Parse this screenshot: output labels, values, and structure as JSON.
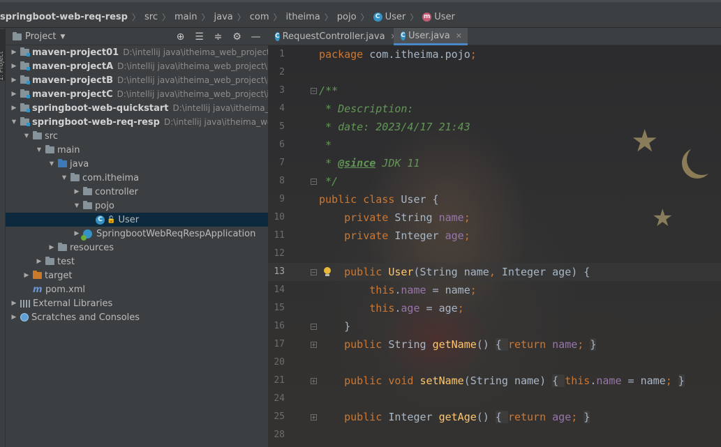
{
  "breadcrumb": {
    "items": [
      {
        "label": "springboot-web-req-resp",
        "icon": ""
      },
      {
        "label": "src",
        "icon": ""
      },
      {
        "label": "main",
        "icon": ""
      },
      {
        "label": "java",
        "icon": ""
      },
      {
        "label": "com",
        "icon": ""
      },
      {
        "label": "itheima",
        "icon": ""
      },
      {
        "label": "pojo",
        "icon": ""
      },
      {
        "label": "User",
        "icon": "C"
      },
      {
        "label": "User",
        "icon": "m"
      }
    ]
  },
  "left_strip": {
    "tab_label": "1: Project"
  },
  "project_panel": {
    "title": "Project",
    "header_icons": [
      "target-icon",
      "expand-all-icon",
      "collapse-all-icon",
      "gear-icon",
      "minimize-icon"
    ],
    "tree": [
      {
        "label": "maven-project01",
        "path": "D:\\intellij java\\itheima_web_project\\ithe",
        "depth": 0,
        "arrow": "right",
        "icon": "module",
        "bold": true
      },
      {
        "label": "maven-projectA",
        "path": "D:\\intellij java\\itheima_web_project\\ithei",
        "depth": 0,
        "arrow": "right",
        "icon": "module",
        "bold": true
      },
      {
        "label": "maven-projectB",
        "path": "D:\\intellij java\\itheima_web_project\\ithei",
        "depth": 0,
        "arrow": "right",
        "icon": "module",
        "bold": true
      },
      {
        "label": "maven-projectC",
        "path": "D:\\intellij java\\itheima_web_project\\ithei",
        "depth": 0,
        "arrow": "right",
        "icon": "module",
        "bold": true
      },
      {
        "label": "springboot-web-quickstart",
        "path": "D:\\intellij java\\itheima_web_p",
        "depth": 0,
        "arrow": "right",
        "icon": "module",
        "bold": true
      },
      {
        "label": "springboot-web-req-resp",
        "path": "D:\\intellij java\\itheima_web_pr",
        "depth": 0,
        "arrow": "down",
        "icon": "module",
        "bold": true
      },
      {
        "label": "src",
        "path": "",
        "depth": 1,
        "arrow": "down",
        "icon": "folder",
        "bold": false
      },
      {
        "label": "main",
        "path": "",
        "depth": 2,
        "arrow": "down",
        "icon": "folder",
        "bold": false
      },
      {
        "label": "java",
        "path": "",
        "depth": 3,
        "arrow": "down",
        "icon": "folder-blue",
        "bold": false
      },
      {
        "label": "com.itheima",
        "path": "",
        "depth": 4,
        "arrow": "down",
        "icon": "package",
        "bold": false
      },
      {
        "label": "controller",
        "path": "",
        "depth": 5,
        "arrow": "right",
        "icon": "package",
        "bold": false
      },
      {
        "label": "pojo",
        "path": "",
        "depth": 5,
        "arrow": "down",
        "icon": "package",
        "bold": false
      },
      {
        "label": "User",
        "path": "",
        "depth": 6,
        "arrow": "none",
        "icon": "class",
        "bold": false,
        "selected": true
      },
      {
        "label": "SpringbootWebReqRespApplication",
        "path": "",
        "depth": 5,
        "arrow": "right",
        "icon": "spring-app",
        "bold": false
      },
      {
        "label": "resources",
        "path": "",
        "depth": 3,
        "arrow": "right",
        "icon": "resources",
        "bold": false
      },
      {
        "label": "test",
        "path": "",
        "depth": 2,
        "arrow": "right",
        "icon": "folder",
        "bold": false
      },
      {
        "label": "target",
        "path": "",
        "depth": 1,
        "arrow": "right",
        "icon": "folder-orange",
        "bold": false
      },
      {
        "label": "pom.xml",
        "path": "",
        "depth": 1,
        "arrow": "none",
        "icon": "maven",
        "bold": false
      },
      {
        "label": "External Libraries",
        "path": "",
        "depth": 0,
        "arrow": "right",
        "icon": "libraries",
        "bold": false
      },
      {
        "label": "Scratches and Consoles",
        "path": "",
        "depth": 0,
        "arrow": "right",
        "icon": "scratches",
        "bold": false
      }
    ]
  },
  "editor": {
    "tabs": [
      {
        "label": "RequestController.java",
        "active": false
      },
      {
        "label": "User.java",
        "active": true
      }
    ],
    "current_line": "13",
    "lines": [
      {
        "num": "1",
        "fold": "",
        "tokens": [
          [
            "kw",
            "package "
          ],
          [
            "",
            "com.itheima.pojo"
          ],
          [
            "kw",
            ";"
          ]
        ]
      },
      {
        "num": "2",
        "fold": "",
        "tokens": []
      },
      {
        "num": "3",
        "fold": "open",
        "tokens": [
          [
            "cm",
            "/**"
          ]
        ]
      },
      {
        "num": "4",
        "fold": "",
        "tokens": [
          [
            "cm",
            " * Description:"
          ]
        ]
      },
      {
        "num": "5",
        "fold": "",
        "tokens": [
          [
            "cm",
            " * date: 2023/4/17 21:43"
          ]
        ]
      },
      {
        "num": "6",
        "fold": "",
        "tokens": [
          [
            "cm",
            " *"
          ]
        ]
      },
      {
        "num": "7",
        "fold": "",
        "tokens": [
          [
            "cm",
            " * "
          ],
          [
            "tag",
            "@since"
          ],
          [
            "cm",
            " JDK 11"
          ]
        ]
      },
      {
        "num": "8",
        "fold": "open",
        "tokens": [
          [
            "cm",
            " */"
          ]
        ]
      },
      {
        "num": "9",
        "fold": "",
        "tokens": [
          [
            "kw",
            "public class "
          ],
          [
            "",
            "User {"
          ]
        ]
      },
      {
        "num": "10",
        "fold": "",
        "tokens": [
          [
            "",
            "    "
          ],
          [
            "kw",
            "private "
          ],
          [
            "",
            "String "
          ],
          [
            "fld",
            "name"
          ],
          [
            "kw",
            ";"
          ]
        ]
      },
      {
        "num": "11",
        "fold": "",
        "tokens": [
          [
            "",
            "    "
          ],
          [
            "kw",
            "private "
          ],
          [
            "",
            "Integer "
          ],
          [
            "fld",
            "age"
          ],
          [
            "kw",
            ";"
          ]
        ]
      },
      {
        "num": "12",
        "fold": "",
        "tokens": []
      },
      {
        "num": "13",
        "fold": "open",
        "bulb": true,
        "tokens": [
          [
            "",
            "    "
          ],
          [
            "kw",
            "public "
          ],
          [
            "fn",
            "User"
          ],
          [
            "",
            "(String name"
          ],
          [
            "kw",
            ", "
          ],
          [
            "",
            "Integer age) {"
          ]
        ]
      },
      {
        "num": "14",
        "fold": "",
        "tokens": [
          [
            "",
            "        "
          ],
          [
            "kw",
            "this"
          ],
          [
            "",
            "."
          ],
          [
            "fld",
            "name"
          ],
          [
            "",
            " = name"
          ],
          [
            "kw",
            ";"
          ]
        ]
      },
      {
        "num": "15",
        "fold": "",
        "tokens": [
          [
            "",
            "        "
          ],
          [
            "kw",
            "this"
          ],
          [
            "",
            "."
          ],
          [
            "fld",
            "age"
          ],
          [
            "",
            " = age"
          ],
          [
            "kw",
            ";"
          ]
        ]
      },
      {
        "num": "16",
        "fold": "open",
        "tokens": [
          [
            "",
            "    }"
          ]
        ]
      },
      {
        "num": "17",
        "fold": "closed",
        "tokens": [
          [
            "",
            "    "
          ],
          [
            "kw",
            "public "
          ],
          [
            "",
            "String "
          ],
          [
            "fn",
            "getName"
          ],
          [
            "",
            "() "
          ],
          [
            "region",
            "{ "
          ],
          [
            "kw",
            "return "
          ],
          [
            "fld",
            "name"
          ],
          [
            "kw",
            "; "
          ],
          [
            "region",
            "}"
          ]
        ]
      },
      {
        "num": "20",
        "fold": "",
        "tokens": []
      },
      {
        "num": "21",
        "fold": "closed",
        "tokens": [
          [
            "",
            "    "
          ],
          [
            "kw",
            "public void "
          ],
          [
            "fn",
            "setName"
          ],
          [
            "",
            "(String name) "
          ],
          [
            "region",
            "{ "
          ],
          [
            "kw",
            "this"
          ],
          [
            "",
            "."
          ],
          [
            "fld",
            "name"
          ],
          [
            "",
            " = name"
          ],
          [
            "kw",
            "; "
          ],
          [
            "region",
            "}"
          ]
        ]
      },
      {
        "num": "24",
        "fold": "",
        "tokens": []
      },
      {
        "num": "25",
        "fold": "closed",
        "tokens": [
          [
            "",
            "    "
          ],
          [
            "kw",
            "public "
          ],
          [
            "",
            "Integer "
          ],
          [
            "fn",
            "getAge"
          ],
          [
            "",
            "() "
          ],
          [
            "region",
            "{ "
          ],
          [
            "kw",
            "return "
          ],
          [
            "fld",
            "age"
          ],
          [
            "kw",
            "; "
          ],
          [
            "region",
            "}"
          ]
        ]
      },
      {
        "num": "28",
        "fold": "",
        "tokens": []
      }
    ]
  },
  "colors": {
    "keyword": "#cc7832",
    "comment": "#629755",
    "field": "#9876aa",
    "method": "#ffc66d",
    "selection": "#0d293e",
    "tab_underline": "#4a88c7"
  }
}
